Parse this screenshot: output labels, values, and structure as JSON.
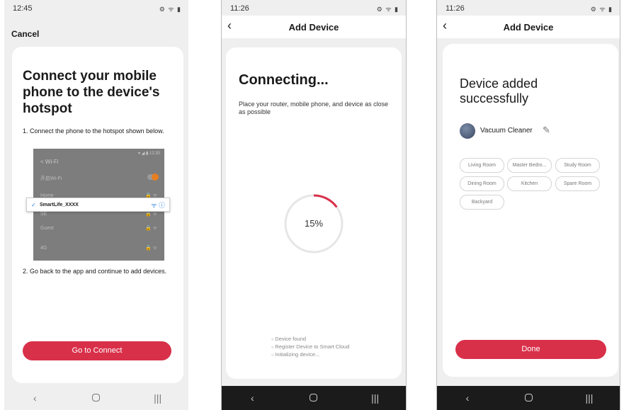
{
  "phone1": {
    "status": {
      "time": "12:45",
      "icons": "⚙ ᯤ ▮"
    },
    "cancel_label": "Cancel",
    "heading": "Connect your mobile phone to the device's hotspot",
    "step1": "1. Connect the phone to the hotspot shown below.",
    "wifi_screen": {
      "status": "▾ ◢ ▮ 12:30",
      "title": "< Wi-Fi",
      "rows": [
        {
          "label": "开启Wi-Fi"
        },
        {
          "label": "Home",
          "icons": "🔒 ᯤ"
        },
        {
          "label": "SE",
          "icons": "🔒 ᯤ"
        },
        {
          "label": "Guest",
          "icons": "🔒 ᯤ"
        },
        {
          "label": "4G",
          "icons": "🔒 ᯤ"
        }
      ],
      "selected": {
        "check": "✓",
        "name": "SmartLife_XXXX",
        "icons": "ᯤ ⓘ"
      }
    },
    "step2": "2. Go back to the app and continue to add devices.",
    "connect_button": "Go to Connect"
  },
  "phone2": {
    "status": {
      "time": "11:26",
      "icons": "⚙ ᯤ ▮"
    },
    "title": "Add Device",
    "heading": "Connecting...",
    "subtitle": "Place your router, mobile phone, and device as close as possible",
    "progress_value": 15,
    "progress_label": "15%",
    "progress_color": "#d9304a",
    "steps": [
      "Device found",
      "Register Device to Smart Cloud",
      "Initializing device..."
    ]
  },
  "phone3": {
    "status": {
      "time": "11:26",
      "icons": "⚙ ᯤ ▮"
    },
    "title": "Add Device",
    "heading": "Device added successfully",
    "device_name": "Vacuum Cleaner",
    "rooms": [
      "Living Room",
      "Master Bedro...",
      "Study Room",
      "Dining Room",
      "Kitchen",
      "Spare Room",
      "Backyard"
    ],
    "done_button": "Done"
  },
  "nav": {
    "back": "‹",
    "home": "",
    "recents": "|||"
  },
  "colors": {
    "accent": "#d9304a",
    "page_bg": "#efefef"
  }
}
